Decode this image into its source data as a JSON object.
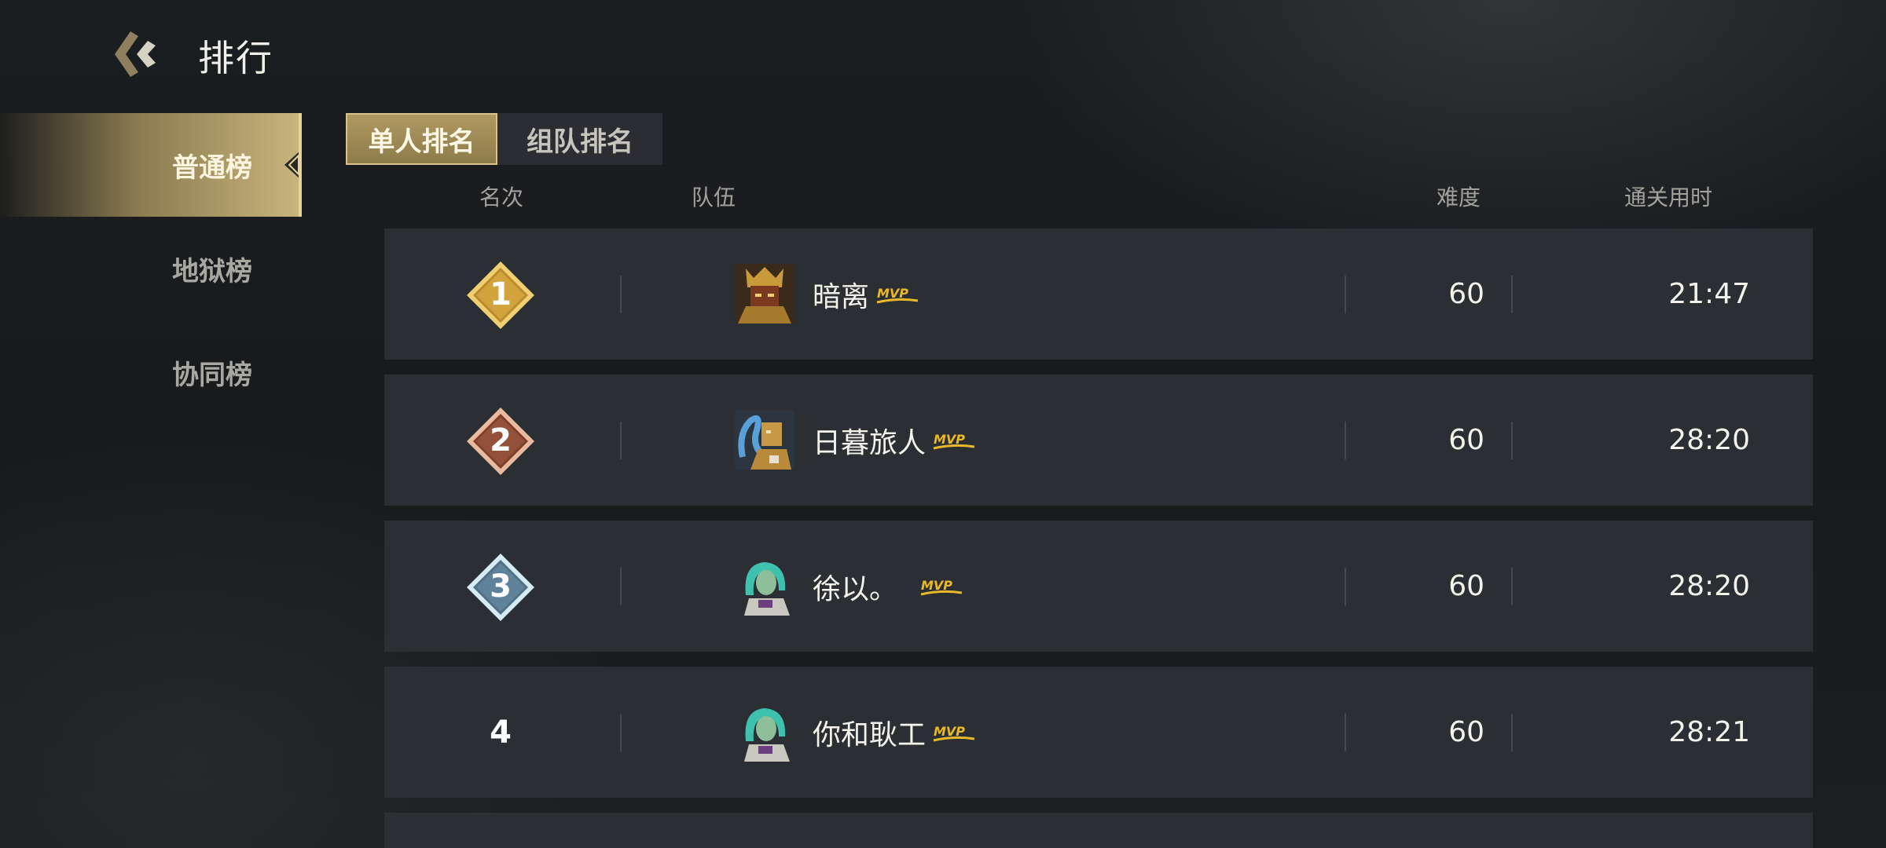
{
  "header": {
    "title": "排行"
  },
  "sidebar": {
    "items": [
      {
        "label": "普通榜",
        "active": true
      },
      {
        "label": "地狱榜",
        "active": false
      },
      {
        "label": "协同榜",
        "active": false
      }
    ]
  },
  "tabs": [
    {
      "label": "单人排名",
      "active": true
    },
    {
      "label": "组队排名",
      "active": false
    }
  ],
  "columns": {
    "rank": "名次",
    "team": "队伍",
    "difficulty": "难度",
    "time": "通关用时"
  },
  "rows": [
    {
      "rank": "1",
      "badge": "gold",
      "name": "暗离",
      "mvp": "MVP",
      "difficulty": "60",
      "time": "21:47",
      "avatar": "armored-knight-avatar"
    },
    {
      "rank": "2",
      "badge": "bronze",
      "name": "日暮旅人",
      "mvp": "MVP",
      "difficulty": "60",
      "time": "28:20",
      "avatar": "serpent-warrior-avatar"
    },
    {
      "rank": "3",
      "badge": "silver",
      "name": "徐以。",
      "mvp": "MVP",
      "difficulty": "60",
      "time": "28:20",
      "avatar": "teal-haired-avatar"
    },
    {
      "rank": "4",
      "badge": "none",
      "name": "你和耿工",
      "mvp": "MVP",
      "difficulty": "60",
      "time": "28:21",
      "avatar": "teal-haired-avatar"
    }
  ],
  "colors": {
    "accent_gold": "#c9b57e",
    "mvp_gold": "#e8b92a",
    "row_bg": "#2b2e32"
  }
}
